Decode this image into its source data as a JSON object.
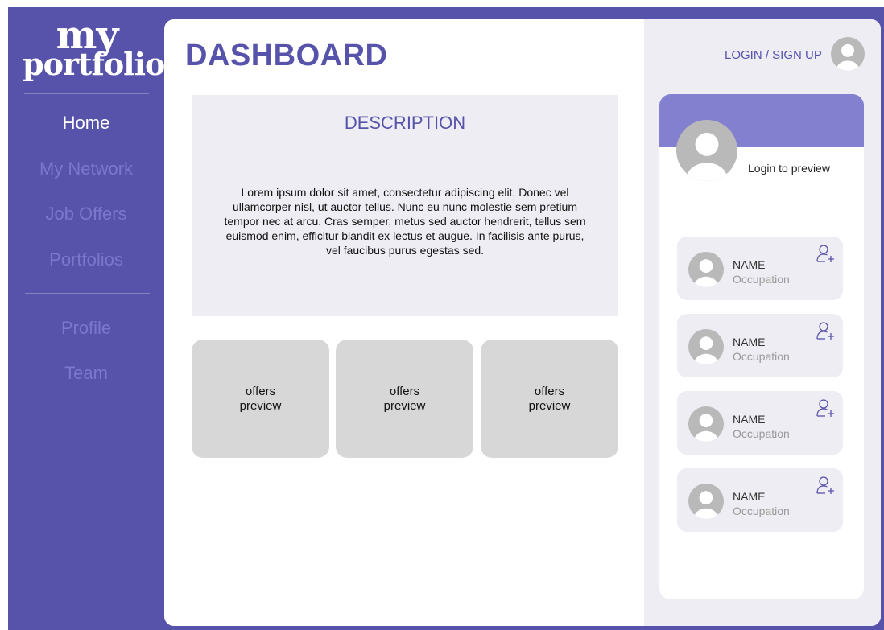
{
  "sidebar": {
    "logo_line1": "my",
    "logo_line2": "portfolio",
    "nav": [
      {
        "label": "Home"
      },
      {
        "label": "My Network"
      },
      {
        "label": "Job Offers"
      },
      {
        "label": "Portfolios"
      }
    ],
    "nav_secondary": [
      {
        "label": "Profile"
      },
      {
        "label": "Team"
      }
    ]
  },
  "main": {
    "title": "DASHBOARD",
    "description": {
      "title": "DESCRIPTION",
      "text": "Lorem ipsum dolor sit amet, consectetur adipiscing elit. Donec vel ullamcorper nisl, ut auctor tellus. Nunc eu nunc molestie sem pretium tempor nec at arcu. Cras semper, metus sed auctor hendrerit, tellus sem euismod enim, efficitur blandit ex lectus et augue. In facilisis ante purus, vel faucibus purus egestas sed."
    },
    "offers": [
      {
        "label": "offers preview"
      },
      {
        "label": "offers preview"
      },
      {
        "label": "offers preview"
      }
    ]
  },
  "right_panel": {
    "login_link": "LOGIN / SIGN UP",
    "profile_card": {
      "login_preview": "Login to preview"
    },
    "people": [
      {
        "name": "NAME",
        "occupation": "Occupation",
        "icon": "add-user-icon"
      },
      {
        "name": "NAME",
        "occupation": "Occupation",
        "icon": "add-user-icon"
      },
      {
        "name": "NAME",
        "occupation": "Occupation",
        "icon": "add-user-icon"
      },
      {
        "name": "NAME",
        "occupation": "Occupation",
        "icon": "add-user-icon"
      }
    ]
  },
  "colors": {
    "brand": "#5753ab",
    "accent_light": "#8480d0",
    "panel_bg": "#eeedf3",
    "card_gray": "#d7d7d7",
    "avatar_gray": "#b9b9b9"
  }
}
